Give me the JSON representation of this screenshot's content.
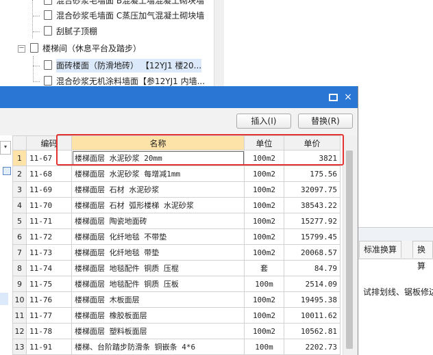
{
  "tree": {
    "items": [
      {
        "label": "混合砂浆毛墙面 B混凝土墙混凝土砌块墙",
        "level": 2
      },
      {
        "label": "混合砂浆毛墙面 C蒸压加气混凝土砌块墙",
        "level": 2
      },
      {
        "label": "刮腻子顶棚",
        "level": 2
      },
      {
        "label": "楼梯间（休息平台及踏步）",
        "level": 1,
        "expander": "－"
      },
      {
        "label": "面砖楼面（防滑地砖）  【12YJ1 楼20...",
        "level": 2,
        "selected": true
      },
      {
        "label": "混合砂浆无机涂料墙面【参12YJ1 内墙...",
        "level": 2
      }
    ]
  },
  "dialog": {
    "maximize_icon": "maximize-icon",
    "close_label": "×",
    "insert_label": "插入(I)",
    "replace_label": "替换(R)",
    "combo_arrow": "▾"
  },
  "grid": {
    "columns": [
      "编码",
      "名称",
      "单位",
      "单价"
    ],
    "rows": [
      {
        "n": "1",
        "code": "11-67",
        "name": "楼梯面层 水泥砂浆 20mm",
        "unit": "100m2",
        "price": "3821"
      },
      {
        "n": "2",
        "code": "11-68",
        "name": "楼梯面层 水泥砂浆 每增减1mm",
        "unit": "100m2",
        "price": "175.56"
      },
      {
        "n": "3",
        "code": "11-69",
        "name": "楼梯面层 石材 水泥砂浆",
        "unit": "100m2",
        "price": "32097.75"
      },
      {
        "n": "4",
        "code": "11-70",
        "name": "楼梯面层 石材 弧形楼梯 水泥砂浆",
        "unit": "100m2",
        "price": "38543.22"
      },
      {
        "n": "5",
        "code": "11-71",
        "name": "楼梯面层 陶瓷地面砖",
        "unit": "100m2",
        "price": "15277.92"
      },
      {
        "n": "6",
        "code": "11-72",
        "name": "楼梯面层 化纤地毯 不带垫",
        "unit": "100m2",
        "price": "15799.45"
      },
      {
        "n": "7",
        "code": "11-73",
        "name": "楼梯面层 化纤地毯 带垫",
        "unit": "100m2",
        "price": "20068.57"
      },
      {
        "n": "8",
        "code": "11-74",
        "name": "楼梯面层 地毯配件 铜质 压棍",
        "unit": "套",
        "price": "84.79"
      },
      {
        "n": "9",
        "code": "11-75",
        "name": "楼梯面层 地毯配件 铜质 压板",
        "unit": "100m",
        "price": "2514.09"
      },
      {
        "n": "10",
        "code": "11-76",
        "name": "楼梯面层 木板面层",
        "unit": "100m2",
        "price": "19495.38"
      },
      {
        "n": "11",
        "code": "11-77",
        "name": "楼梯面层 橡胶板面层",
        "unit": "100m2",
        "price": "10011.62"
      },
      {
        "n": "12",
        "code": "11-78",
        "name": "楼梯面层 塑料板面层",
        "unit": "100m2",
        "price": "10562.81"
      },
      {
        "n": "13",
        "code": "11-91",
        "name": "楼梯、台阶踏步防滑条 铜嵌条 4*6",
        "unit": "100m",
        "price": "2202.73"
      }
    ]
  },
  "background": {
    "tab1": "标准换算",
    "tab2": "换算",
    "text": "试排划线、锯板修边"
  },
  "colors": {
    "titlebar": "#2a76d4",
    "highlight_header": "#fde3a8",
    "annotation": "#e3312d"
  }
}
